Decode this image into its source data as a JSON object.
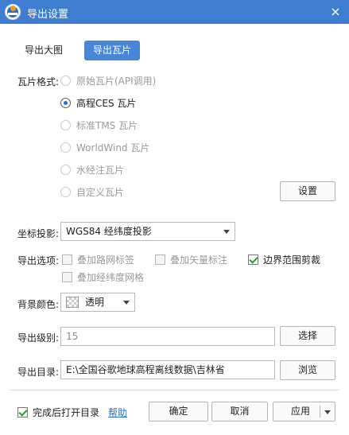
{
  "window": {
    "title": "导出设置",
    "close_icon": "×"
  },
  "tabs": [
    {
      "label": "导出大图",
      "active": false
    },
    {
      "label": "导出瓦片",
      "active": true
    }
  ],
  "tile_format": {
    "label": "瓦片格式:",
    "options": [
      {
        "label": "原始瓦片(API调用)",
        "checked": false,
        "enabled": false
      },
      {
        "label": "高程CES 瓦片",
        "checked": true,
        "enabled": true
      },
      {
        "label": "标准TMS 瓦片",
        "checked": false,
        "enabled": false
      },
      {
        "label": "WorldWind 瓦片",
        "checked": false,
        "enabled": false
      },
      {
        "label": "水经注瓦片",
        "checked": false,
        "enabled": false
      },
      {
        "label": "自定义瓦片",
        "checked": false,
        "enabled": false
      }
    ],
    "settings_button": "设置"
  },
  "projection": {
    "label": "坐标投影:",
    "value": "WGS84 经纬度投影"
  },
  "export_options": {
    "label": "导出选项:",
    "items": [
      {
        "label": "叠加路网标签",
        "checked": false,
        "enabled": false
      },
      {
        "label": "叠加矢量标注",
        "checked": false,
        "enabled": false
      },
      {
        "label": "边界范围剪裁",
        "checked": true,
        "enabled": true
      },
      {
        "label": "叠加经纬度网格",
        "checked": false,
        "enabled": false
      }
    ]
  },
  "background": {
    "label": "背景颜色:",
    "value": "透明"
  },
  "level": {
    "label": "导出级别:",
    "value": "15",
    "button": "选择"
  },
  "directory": {
    "label": "导出目录:",
    "value": "E:\\全国谷歌地球高程离线数据\\吉林省",
    "button": "浏览"
  },
  "footer": {
    "open_after": {
      "label": "完成后打开目录",
      "checked": true
    },
    "help_link": "帮助",
    "ok": "确定",
    "cancel": "取消",
    "apply": "应用"
  },
  "colors": {
    "titlebar": "#3e7dd0",
    "accent": "#4a86d8",
    "link": "#2a6cc7"
  }
}
